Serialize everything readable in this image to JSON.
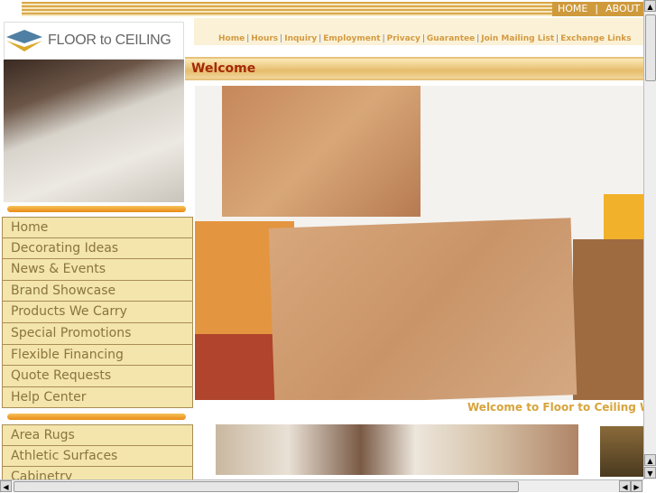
{
  "top_links": [
    "HOME",
    "|",
    "ABOUT US"
  ],
  "logo": {
    "text": "FLOOR to CEILING"
  },
  "nav": [
    "Home",
    "Hours",
    "Inquiry",
    "Employment",
    "Privacy",
    "Guarantee",
    "Join Mailing List",
    "Exchange Links"
  ],
  "section_title": "Welcome",
  "caption": "Welcome to Floor to Ceiling Wil",
  "menu1": [
    "Home",
    "Decorating Ideas",
    "News & Events",
    "Brand Showcase",
    "Products We Carry",
    "Special Promotions",
    "Flexible Financing",
    "Quote Requests",
    "Help Center"
  ],
  "menu2": [
    "Area Rugs",
    "Athletic Surfaces",
    "Cabinetry"
  ],
  "colors": {
    "accent": "#d39a41",
    "title": "#a32a08",
    "menu_bg": "#f3e5ac"
  }
}
